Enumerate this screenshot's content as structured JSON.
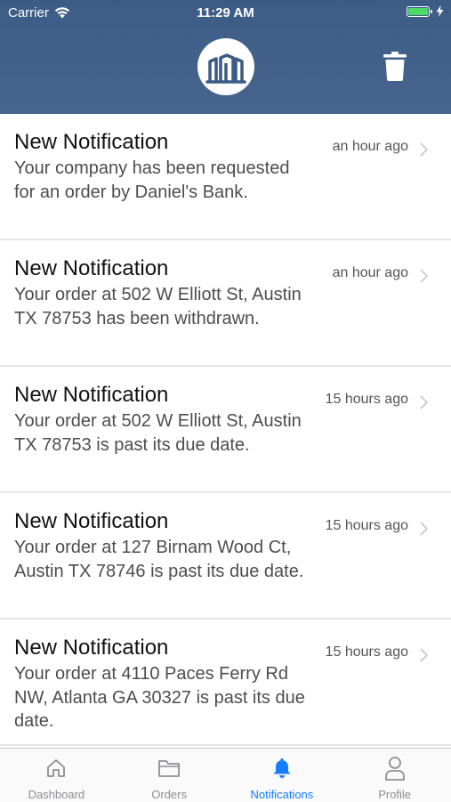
{
  "status_bar": {
    "carrier": "Carrier",
    "time": "11:29 AM"
  },
  "header": {
    "logo_icon": "building-columns-icon",
    "trash_icon": "trash-icon",
    "background_color": "#3f5f8a"
  },
  "notifications": [
    {
      "title": "New Notification",
      "message": "Your company has been requested for an order by Daniel's Bank.",
      "time": "an hour ago"
    },
    {
      "title": "New Notification",
      "message": "Your order at 502 W Elliott St, Austin TX 78753 has been withdrawn.",
      "time": "an hour ago"
    },
    {
      "title": "New Notification",
      "message": "Your order at 502 W Elliott St, Austin TX 78753 is past its due date.",
      "time": "15 hours ago"
    },
    {
      "title": "New Notification",
      "message": "Your order at 127 Birnam Wood Ct, Austin TX 78746 is past its due date.",
      "time": "15 hours ago"
    },
    {
      "title": "New Notification",
      "message": "Your order at 4110 Paces Ferry Rd NW, Atlanta GA 30327 is past its due date.",
      "time": "15 hours ago"
    }
  ],
  "tab_bar": {
    "active_color": "#147efb",
    "tabs": [
      {
        "label": "Dashboard",
        "icon": "home-icon",
        "active": false
      },
      {
        "label": "Orders",
        "icon": "folder-icon",
        "active": false
      },
      {
        "label": "Notifications",
        "icon": "bell-icon",
        "active": true
      },
      {
        "label": "Profile",
        "icon": "user-icon",
        "active": false
      }
    ]
  }
}
